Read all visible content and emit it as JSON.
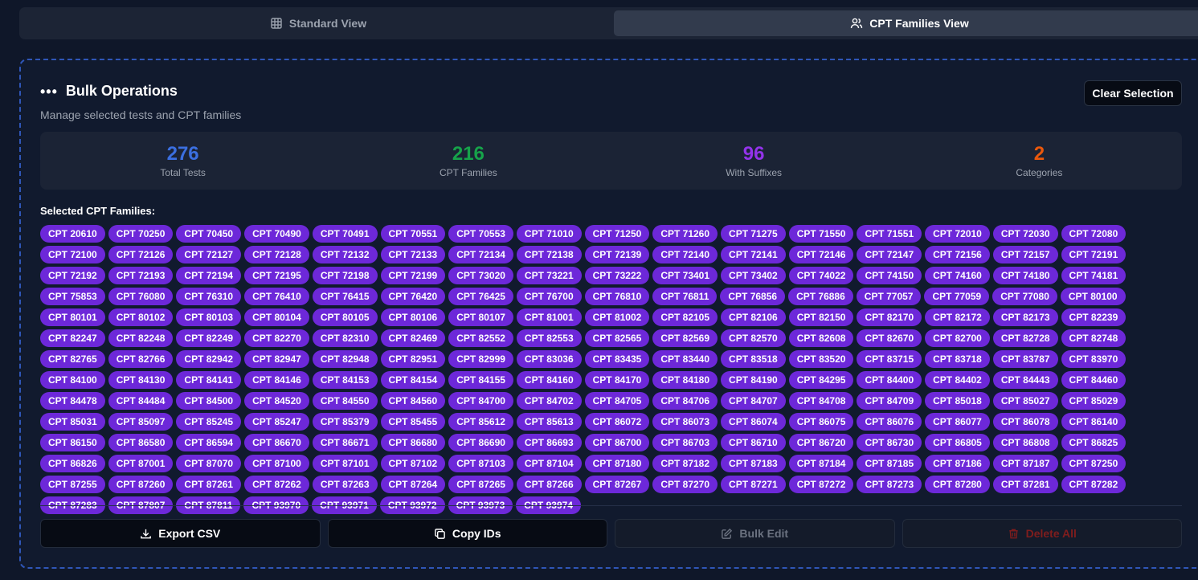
{
  "tabs": [
    {
      "label": "Standard View",
      "icon": "grid-icon",
      "active": false
    },
    {
      "label": "CPT Families View",
      "icon": "users-icon",
      "active": true
    }
  ],
  "bulk": {
    "title": "Bulk Operations",
    "subtitle": "Manage selected tests and CPT families",
    "clear_label": "Clear Selection"
  },
  "stats": [
    {
      "value": "276",
      "label": "Total Tests",
      "color": "#3b6fe0"
    },
    {
      "value": "216",
      "label": "CPT Families",
      "color": "#16a34a"
    },
    {
      "value": "96",
      "label": "With Suffixes",
      "color": "#9333ea"
    },
    {
      "value": "2",
      "label": "Categories",
      "color": "#ea580c"
    }
  ],
  "selected_label": "Selected CPT Families:",
  "cpt_families": [
    "CPT 20610",
    "CPT 70250",
    "CPT 70450",
    "CPT 70490",
    "CPT 70491",
    "CPT 70551",
    "CPT 70553",
    "CPT 71010",
    "CPT 71250",
    "CPT 71260",
    "CPT 71275",
    "CPT 71550",
    "CPT 71551",
    "CPT 72010",
    "CPT 72030",
    "CPT 72080",
    "CPT 72100",
    "CPT 72126",
    "CPT 72127",
    "CPT 72128",
    "CPT 72132",
    "CPT 72133",
    "CPT 72134",
    "CPT 72138",
    "CPT 72139",
    "CPT 72140",
    "CPT 72141",
    "CPT 72146",
    "CPT 72147",
    "CPT 72156",
    "CPT 72157",
    "CPT 72191",
    "CPT 72192",
    "CPT 72193",
    "CPT 72194",
    "CPT 72195",
    "CPT 72198",
    "CPT 72199",
    "CPT 73020",
    "CPT 73221",
    "CPT 73222",
    "CPT 73401",
    "CPT 73402",
    "CPT 74022",
    "CPT 74150",
    "CPT 74160",
    "CPT 74180",
    "CPT 74181",
    "CPT 75853",
    "CPT 76080",
    "CPT 76310",
    "CPT 76410",
    "CPT 76415",
    "CPT 76420",
    "CPT 76425",
    "CPT 76700",
    "CPT 76810",
    "CPT 76811",
    "CPT 76856",
    "CPT 76886",
    "CPT 77057",
    "CPT 77059",
    "CPT 77080",
    "CPT 80100",
    "CPT 80101",
    "CPT 80102",
    "CPT 80103",
    "CPT 80104",
    "CPT 80105",
    "CPT 80106",
    "CPT 80107",
    "CPT 81001",
    "CPT 81002",
    "CPT 82105",
    "CPT 82106",
    "CPT 82150",
    "CPT 82170",
    "CPT 82172",
    "CPT 82173",
    "CPT 82239",
    "CPT 82247",
    "CPT 82248",
    "CPT 82249",
    "CPT 82270",
    "CPT 82310",
    "CPT 82469",
    "CPT 82552",
    "CPT 82553",
    "CPT 82565",
    "CPT 82569",
    "CPT 82570",
    "CPT 82608",
    "CPT 82670",
    "CPT 82700",
    "CPT 82728",
    "CPT 82748",
    "CPT 82765",
    "CPT 82766",
    "CPT 82942",
    "CPT 82947",
    "CPT 82948",
    "CPT 82951",
    "CPT 82999",
    "CPT 83036",
    "CPT 83435",
    "CPT 83440",
    "CPT 83518",
    "CPT 83520",
    "CPT 83715",
    "CPT 83718",
    "CPT 83787",
    "CPT 83970",
    "CPT 84100",
    "CPT 84130",
    "CPT 84141",
    "CPT 84146",
    "CPT 84153",
    "CPT 84154",
    "CPT 84155",
    "CPT 84160",
    "CPT 84170",
    "CPT 84180",
    "CPT 84190",
    "CPT 84295",
    "CPT 84400",
    "CPT 84402",
    "CPT 84443",
    "CPT 84460",
    "CPT 84478",
    "CPT 84484",
    "CPT 84500",
    "CPT 84520",
    "CPT 84550",
    "CPT 84560",
    "CPT 84700",
    "CPT 84702",
    "CPT 84705",
    "CPT 84706",
    "CPT 84707",
    "CPT 84708",
    "CPT 84709",
    "CPT 85018",
    "CPT 85027",
    "CPT 85029",
    "CPT 85031",
    "CPT 85097",
    "CPT 85245",
    "CPT 85247",
    "CPT 85379",
    "CPT 85455",
    "CPT 85612",
    "CPT 85613",
    "CPT 86072",
    "CPT 86073",
    "CPT 86074",
    "CPT 86075",
    "CPT 86076",
    "CPT 86077",
    "CPT 86078",
    "CPT 86140",
    "CPT 86150",
    "CPT 86580",
    "CPT 86594",
    "CPT 86670",
    "CPT 86671",
    "CPT 86680",
    "CPT 86690",
    "CPT 86693",
    "CPT 86700",
    "CPT 86703",
    "CPT 86710",
    "CPT 86720",
    "CPT 86730",
    "CPT 86805",
    "CPT 86808",
    "CPT 86825",
    "CPT 86826",
    "CPT 87001",
    "CPT 87070",
    "CPT 87100",
    "CPT 87101",
    "CPT 87102",
    "CPT 87103",
    "CPT 87104",
    "CPT 87180",
    "CPT 87182",
    "CPT 87183",
    "CPT 87184",
    "CPT 87185",
    "CPT 87186",
    "CPT 87187",
    "CPT 87250",
    "CPT 87255",
    "CPT 87260",
    "CPT 87261",
    "CPT 87262",
    "CPT 87263",
    "CPT 87264",
    "CPT 87265",
    "CPT 87266",
    "CPT 87267",
    "CPT 87270",
    "CPT 87271",
    "CPT 87272",
    "CPT 87273",
    "CPT 87280",
    "CPT 87281",
    "CPT 87282",
    "CPT 87283",
    "CPT 87807",
    "CPT 87811",
    "CPT 93970",
    "CPT 93971",
    "CPT 93972",
    "CPT 93973",
    "CPT 93974"
  ],
  "actions": [
    {
      "label": "Export CSV",
      "icon": "download-icon",
      "state": "enabled"
    },
    {
      "label": "Copy IDs",
      "icon": "copy-icon",
      "state": "enabled"
    },
    {
      "label": "Bulk Edit",
      "icon": "edit-icon",
      "state": "disabled"
    },
    {
      "label": "Delete All",
      "icon": "trash-icon",
      "state": "disabled-danger"
    }
  ]
}
